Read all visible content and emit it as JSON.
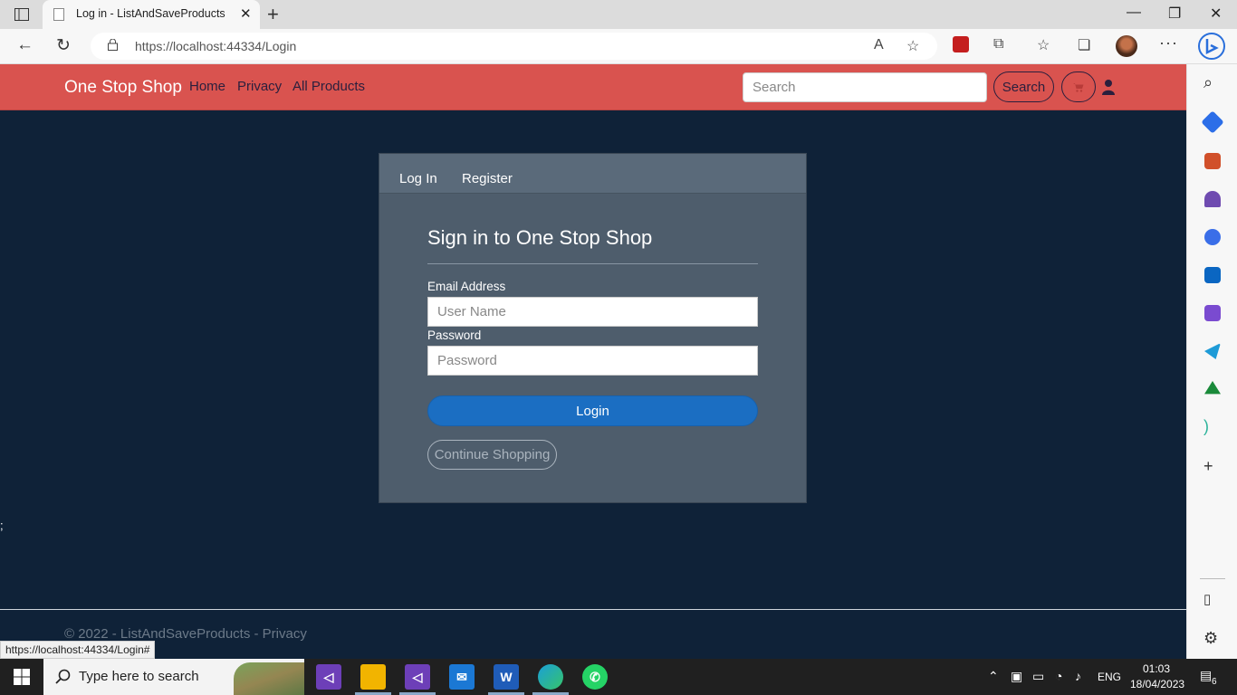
{
  "browser": {
    "tab_title": "Log in - ListAndSaveProducts",
    "url": "https://localhost:44334/Login",
    "status_url": "https://localhost:44334/Login#"
  },
  "site": {
    "brand": "One Stop Shop",
    "nav": {
      "home": "Home",
      "privacy": "Privacy",
      "all_products": "All Products"
    },
    "search": {
      "placeholder": "Search",
      "button": "Search"
    }
  },
  "login": {
    "tabs": {
      "login": "Log In",
      "register": "Register"
    },
    "title": "Sign in to One Stop Shop",
    "email_label": "Email Address",
    "email_placeholder": "User Name",
    "password_label": "Password",
    "password_placeholder": "Password",
    "login_button": "Login",
    "continue_button": "Continue Shopping"
  },
  "stray_text": ";",
  "footer": {
    "text": "© 2022 - ListAndSaveProducts - Privacy"
  },
  "taskbar": {
    "search_placeholder": "Type here to search",
    "language": "ENG",
    "time": "01:03",
    "date": "18/04/2023",
    "notification_count": "6"
  },
  "colors": {
    "navbar": "#d9534f",
    "page_background": "#0f2238",
    "card": "#4e5d6c",
    "primary_button": "#1b6ec2"
  }
}
